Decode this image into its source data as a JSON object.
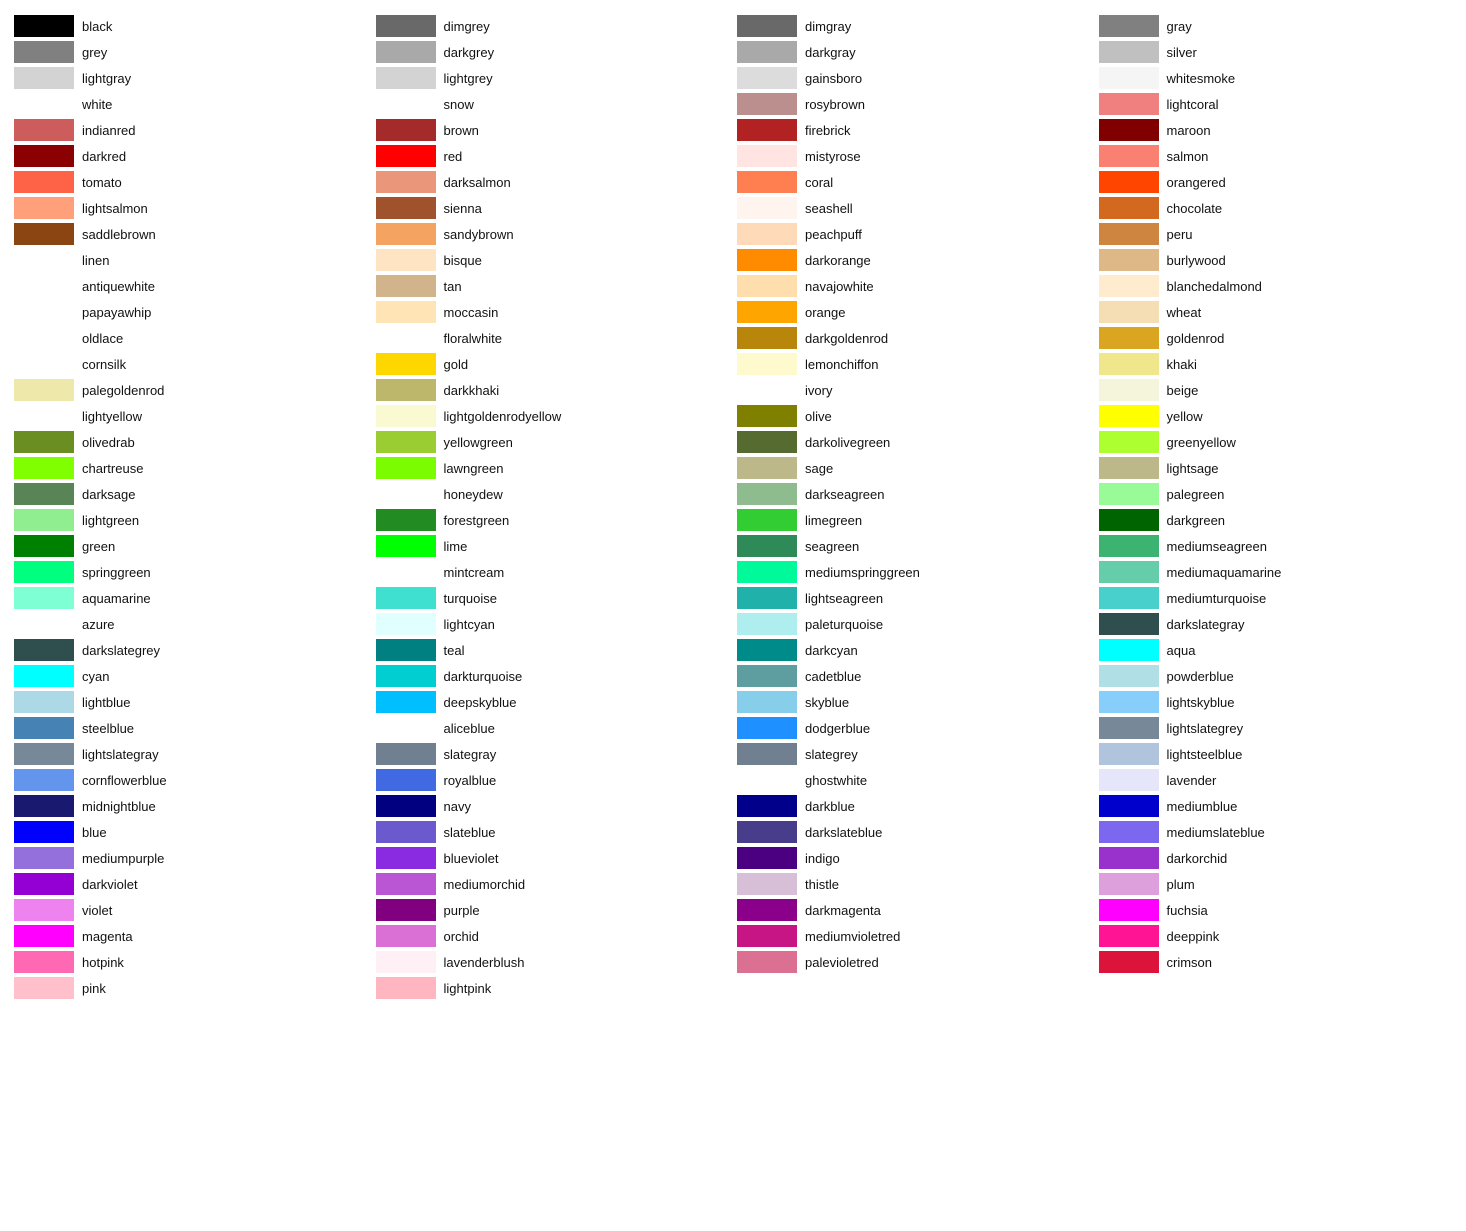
{
  "columns": [
    [
      {
        "name": "black",
        "color": "#000000"
      },
      {
        "name": "grey",
        "color": "#808080"
      },
      {
        "name": "lightgray",
        "color": "#d3d3d3"
      },
      {
        "name": "white",
        "color": null
      },
      {
        "name": "indianred",
        "color": "#cd5c5c"
      },
      {
        "name": "darkred",
        "color": "#8b0000"
      },
      {
        "name": "tomato",
        "color": "#ff6347"
      },
      {
        "name": "lightsalmon",
        "color": "#ffa07a"
      },
      {
        "name": "saddlebrown",
        "color": "#8b4513"
      },
      {
        "name": "linen",
        "color": null
      },
      {
        "name": "antiquewhite",
        "color": null
      },
      {
        "name": "papayawhip",
        "color": null
      },
      {
        "name": "oldlace",
        "color": null
      },
      {
        "name": "cornsilk",
        "color": null
      },
      {
        "name": "palegoldenrod",
        "color": "#eee8aa"
      },
      {
        "name": "lightyellow",
        "color": null
      },
      {
        "name": "olivedrab",
        "color": "#6b8e23"
      },
      {
        "name": "chartreuse",
        "color": "#7fff00"
      },
      {
        "name": "darksage",
        "color": "#598556"
      },
      {
        "name": "lightgreen",
        "color": "#90ee90"
      },
      {
        "name": "green",
        "color": "#008000"
      },
      {
        "name": "springgreen",
        "color": "#00ff7f"
      },
      {
        "name": "aquamarine",
        "color": "#7fffd4"
      },
      {
        "name": "azure",
        "color": null
      },
      {
        "name": "darkslategrey",
        "color": "#2f4f4f"
      },
      {
        "name": "cyan",
        "color": "#00ffff"
      },
      {
        "name": "lightblue",
        "color": "#add8e6"
      },
      {
        "name": "steelblue",
        "color": "#4682b4"
      },
      {
        "name": "lightslategray",
        "color": "#778899"
      },
      {
        "name": "cornflowerblue",
        "color": "#6495ed"
      },
      {
        "name": "midnightblue",
        "color": "#191970"
      },
      {
        "name": "blue",
        "color": "#0000ff"
      },
      {
        "name": "mediumpurple",
        "color": "#9370db"
      },
      {
        "name": "darkviolet",
        "color": "#9400d3"
      },
      {
        "name": "violet",
        "color": "#ee82ee"
      },
      {
        "name": "magenta",
        "color": "#ff00ff"
      },
      {
        "name": "hotpink",
        "color": "#ff69b4"
      },
      {
        "name": "pink",
        "color": "#ffc0cb"
      }
    ],
    [
      {
        "name": "dimgrey",
        "color": "#696969"
      },
      {
        "name": "darkgrey",
        "color": "#a9a9a9"
      },
      {
        "name": "lightgrey",
        "color": "#d3d3d3"
      },
      {
        "name": "snow",
        "color": null
      },
      {
        "name": "brown",
        "color": "#a52a2a"
      },
      {
        "name": "red",
        "color": "#ff0000"
      },
      {
        "name": "darksalmon",
        "color": "#e9967a"
      },
      {
        "name": "sienna",
        "color": "#a0522d"
      },
      {
        "name": "sandybrown",
        "color": "#f4a460"
      },
      {
        "name": "bisque",
        "color": "#ffe4c4"
      },
      {
        "name": "tan",
        "color": "#d2b48c"
      },
      {
        "name": "moccasin",
        "color": "#ffe4b5"
      },
      {
        "name": "floralwhite",
        "color": null
      },
      {
        "name": "gold",
        "color": "#ffd700"
      },
      {
        "name": "darkkhaki",
        "color": "#bdb76b"
      },
      {
        "name": "lightgoldenrodyellow",
        "color": "#fafad2"
      },
      {
        "name": "yellowgreen",
        "color": "#9acd32"
      },
      {
        "name": "lawngreen",
        "color": "#7cfc00"
      },
      {
        "name": "honeydew",
        "color": null
      },
      {
        "name": "forestgreen",
        "color": "#228b22"
      },
      {
        "name": "lime",
        "color": "#00ff00"
      },
      {
        "name": "mintcream",
        "color": null
      },
      {
        "name": "turquoise",
        "color": "#40e0d0"
      },
      {
        "name": "lightcyan",
        "color": "#e0ffff"
      },
      {
        "name": "teal",
        "color": "#008080"
      },
      {
        "name": "darkturquoise",
        "color": "#00ced1"
      },
      {
        "name": "deepskyblue",
        "color": "#00bfff"
      },
      {
        "name": "aliceblue",
        "color": null
      },
      {
        "name": "slategray",
        "color": "#708090"
      },
      {
        "name": "royalblue",
        "color": "#4169e1"
      },
      {
        "name": "navy",
        "color": "#000080"
      },
      {
        "name": "slateblue",
        "color": "#6a5acd"
      },
      {
        "name": "blueviolet",
        "color": "#8a2be2"
      },
      {
        "name": "mediumorchid",
        "color": "#ba55d3"
      },
      {
        "name": "purple",
        "color": "#800080"
      },
      {
        "name": "orchid",
        "color": "#da70d6"
      },
      {
        "name": "lavenderblush",
        "color": "#fff0f5"
      },
      {
        "name": "lightpink",
        "color": "#ffb6c1"
      }
    ],
    [
      {
        "name": "dimgray",
        "color": "#696969"
      },
      {
        "name": "darkgray",
        "color": "#a9a9a9"
      },
      {
        "name": "gainsboro",
        "color": "#dcdcdc"
      },
      {
        "name": "rosybrown",
        "color": "#bc8f8f"
      },
      {
        "name": "firebrick",
        "color": "#b22222"
      },
      {
        "name": "mistyrose",
        "color": "#ffe4e1"
      },
      {
        "name": "coral",
        "color": "#ff7f50"
      },
      {
        "name": "seashell",
        "color": "#fff5ee"
      },
      {
        "name": "peachpuff",
        "color": "#ffdab9"
      },
      {
        "name": "darkorange",
        "color": "#ff8c00"
      },
      {
        "name": "navajowhite",
        "color": "#ffdead"
      },
      {
        "name": "orange",
        "color": "#ffa500"
      },
      {
        "name": "darkgoldenrod",
        "color": "#b8860b"
      },
      {
        "name": "lemonchiffon",
        "color": "#fffacd"
      },
      {
        "name": "ivory",
        "color": null
      },
      {
        "name": "olive",
        "color": "#808000"
      },
      {
        "name": "darkolivegreen",
        "color": "#556b2f"
      },
      {
        "name": "sage",
        "color": "#bcb88a"
      },
      {
        "name": "darkseagreen",
        "color": "#8fbc8f"
      },
      {
        "name": "limegreen",
        "color": "#32cd32"
      },
      {
        "name": "seagreen",
        "color": "#2e8b57"
      },
      {
        "name": "mediumspringgreen",
        "color": "#00fa9a"
      },
      {
        "name": "lightseagreen",
        "color": "#20b2aa"
      },
      {
        "name": "paleturquoise",
        "color": "#afeeee"
      },
      {
        "name": "darkcyan",
        "color": "#008b8b"
      },
      {
        "name": "cadetblue",
        "color": "#5f9ea0"
      },
      {
        "name": "skyblue",
        "color": "#87ceeb"
      },
      {
        "name": "dodgerblue",
        "color": "#1e90ff"
      },
      {
        "name": "slategrey",
        "color": "#708090"
      },
      {
        "name": "ghostwhite",
        "color": null
      },
      {
        "name": "darkblue",
        "color": "#00008b"
      },
      {
        "name": "darkslateblue",
        "color": "#483d8b"
      },
      {
        "name": "indigo",
        "color": "#4b0082"
      },
      {
        "name": "thistle",
        "color": "#d8bfd8"
      },
      {
        "name": "darkmagenta",
        "color": "#8b008b"
      },
      {
        "name": "mediumvioletred",
        "color": "#c71585"
      },
      {
        "name": "palevioletred",
        "color": "#db7093"
      }
    ],
    [
      {
        "name": "gray",
        "color": "#808080"
      },
      {
        "name": "silver",
        "color": "#c0c0c0"
      },
      {
        "name": "whitesmoke",
        "color": "#f5f5f5"
      },
      {
        "name": "lightcoral",
        "color": "#f08080"
      },
      {
        "name": "maroon",
        "color": "#800000"
      },
      {
        "name": "salmon",
        "color": "#fa8072"
      },
      {
        "name": "orangered",
        "color": "#ff4500"
      },
      {
        "name": "chocolate",
        "color": "#d2691e"
      },
      {
        "name": "peru",
        "color": "#cd853f"
      },
      {
        "name": "burlywood",
        "color": "#deb887"
      },
      {
        "name": "blanchedalmond",
        "color": "#ffebcd"
      },
      {
        "name": "wheat",
        "color": "#f5deb3"
      },
      {
        "name": "goldenrod",
        "color": "#daa520"
      },
      {
        "name": "khaki",
        "color": "#f0e68c"
      },
      {
        "name": "beige",
        "color": "#f5f5dc"
      },
      {
        "name": "yellow",
        "color": "#ffff00"
      },
      {
        "name": "greenyellow",
        "color": "#adff2f"
      },
      {
        "name": "lightsage",
        "color": "#bcb88a"
      },
      {
        "name": "palegreen",
        "color": "#98fb98"
      },
      {
        "name": "darkgreen",
        "color": "#006400"
      },
      {
        "name": "mediumseagreen",
        "color": "#3cb371"
      },
      {
        "name": "mediumaquamarine",
        "color": "#66cdaa"
      },
      {
        "name": "mediumturquoise",
        "color": "#48d1cc"
      },
      {
        "name": "darkslategray",
        "color": "#2f4f4f"
      },
      {
        "name": "aqua",
        "color": "#00ffff"
      },
      {
        "name": "powderblue",
        "color": "#b0e0e6"
      },
      {
        "name": "lightskyblue",
        "color": "#87cefa"
      },
      {
        "name": "lightslategrey",
        "color": "#778899"
      },
      {
        "name": "lightsteelblue",
        "color": "#b0c4de"
      },
      {
        "name": "lavender",
        "color": "#e6e6fa"
      },
      {
        "name": "mediumblue",
        "color": "#0000cd"
      },
      {
        "name": "mediumslateblue",
        "color": "#7b68ee"
      },
      {
        "name": "darkorchid",
        "color": "#9932cc"
      },
      {
        "name": "plum",
        "color": "#dda0dd"
      },
      {
        "name": "fuchsia",
        "color": "#ff00ff"
      },
      {
        "name": "deeppink",
        "color": "#ff1493"
      },
      {
        "name": "crimson",
        "color": "#dc143c"
      }
    ]
  ]
}
